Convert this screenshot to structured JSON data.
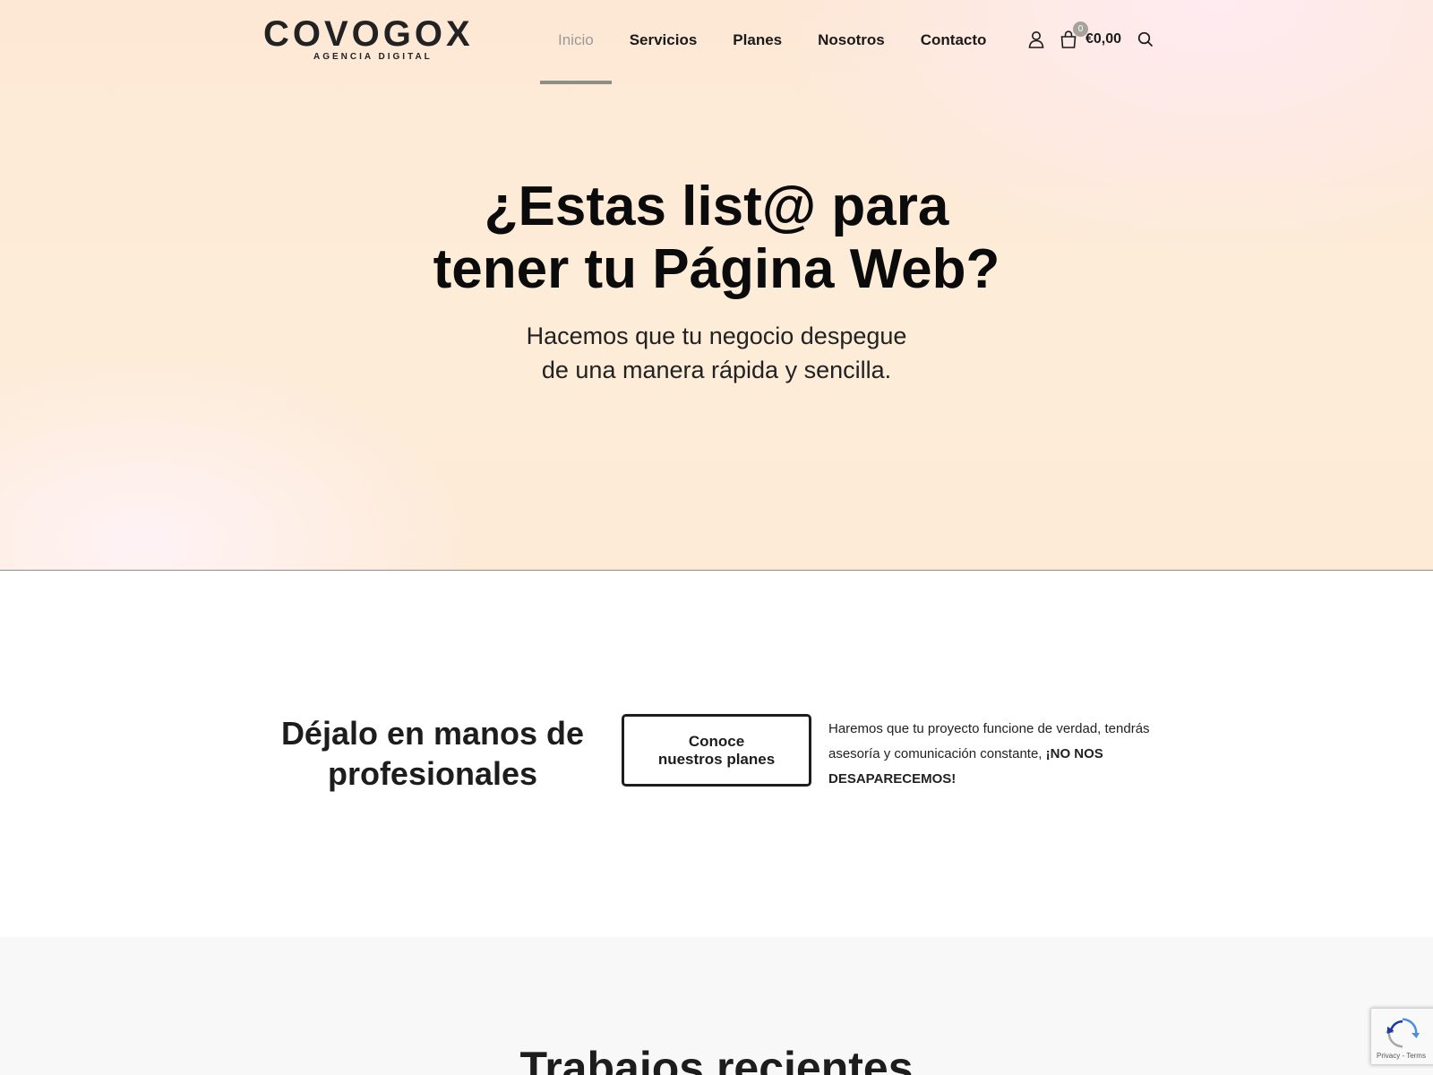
{
  "brand": {
    "name": "COVOGOX",
    "tagline": "AGENCIA DIGITAL"
  },
  "nav": {
    "items": [
      {
        "label": "Inicio",
        "active": true
      },
      {
        "label": "Servicios",
        "active": false
      },
      {
        "label": "Planes",
        "active": false
      },
      {
        "label": "Nosotros",
        "active": false
      },
      {
        "label": "Contacto",
        "active": false
      }
    ]
  },
  "header_tools": {
    "account_icon": "user-icon",
    "cart_icon": "shopping-bag-icon",
    "cart_count": "0",
    "cart_total": "€0,00",
    "search_icon": "search-icon"
  },
  "hero": {
    "title_line1": "¿Estas list@ para",
    "title_line2": "tener tu Página Web?",
    "subtitle_line1": "Hacemos que tu negocio despegue",
    "subtitle_line2": "de una manera rápida y sencilla."
  },
  "professionals": {
    "heading_line1": "Déjalo en manos de",
    "heading_line2": "profesionales",
    "button_line1": "Conoce",
    "button_line2": "nuestros planes",
    "text": "Haremos que tu proyecto funcione de verdad, tendrás asesoría y comunicación constante, ",
    "text_bold": "¡NO NOS DESAPARECEMOS!"
  },
  "works": {
    "title": "Trabajos recientes"
  },
  "recaptcha": {
    "links": "Privacy - Terms"
  },
  "colors": {
    "accent": "#8d8f84",
    "badge": "#a6a49a",
    "text": "#1d1d1d"
  }
}
